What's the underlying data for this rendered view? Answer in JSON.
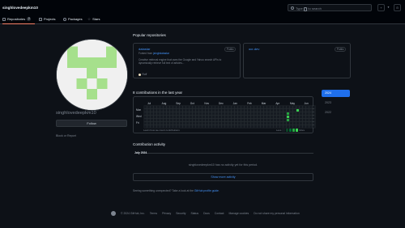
{
  "header": {
    "title": "singhlovedeepkm10",
    "search_placeholder_before": "Type",
    "search_placeholder_key": "/",
    "search_placeholder_after": "to search",
    "buttons": [
      "+",
      "▾",
      "⊙"
    ]
  },
  "tabs": [
    {
      "label": "Repositories",
      "count": "2",
      "icon": "repo-icon"
    },
    {
      "label": "Projects",
      "icon": "project-icon"
    },
    {
      "label": "Packages",
      "icon": "package-icon"
    },
    {
      "label": "Stars",
      "icon": "star-icon"
    }
  ],
  "profile": {
    "name": "singhlovedeepkm10",
    "follow_label": "Follow",
    "block_report": "Block or Report"
  },
  "popular": {
    "title": "Popular repositories",
    "repos": [
      {
        "name": "datastar",
        "badge": "Public",
        "forked_prefix": "Forked from",
        "forked_from": "jsinghdatastar",
        "description": "Creative retrieval engine that uses the Google and Yahoo search APIs to dynamically retrieve full text of articles...",
        "language": "Roff",
        "lang_color": "#ecdebe"
      },
      {
        "name": "ocr-dev",
        "badge": "Public",
        "forked_prefix": "",
        "forked_from": "",
        "description": "",
        "language": "",
        "lang_color": ""
      }
    ]
  },
  "contrib": {
    "title": "8 contributions in the last year",
    "months": [
      "Jul",
      "Aug",
      "Sep",
      "Oct",
      "Nov",
      "Dec",
      "Jan",
      "Feb",
      "Mar",
      "Apr",
      "May",
      "Jun"
    ],
    "days": [
      "Mon",
      "Wed",
      "Fri"
    ],
    "footer_link": "Learn how we count contributions",
    "less": "Less",
    "more": "More",
    "colors": [
      "#161b22",
      "#0e4429",
      "#006d32",
      "#26a641",
      "#39d353"
    ],
    "active_cells": [
      {
        "week": 44,
        "day": 2,
        "level": 3
      },
      {
        "week": 44,
        "day": 3,
        "level": 4
      },
      {
        "week": 44,
        "day": 4,
        "level": 3
      },
      {
        "week": 47,
        "day": 1,
        "level": 4
      }
    ]
  },
  "years": [
    "2024",
    "2023",
    "2022"
  ],
  "activity": {
    "title": "Contribution activity",
    "month": "July 2024",
    "message": "singhlovedeepkm10 has no activity yet for this period.",
    "show_more": "Show more activity",
    "unexpected_prefix": "Seeing something unexpected? Take a look at the",
    "unexpected_link": "GitHub profile guide",
    "unexpected_suffix": "."
  },
  "footer": {
    "copyright": "© 2024 GitHub, Inc.",
    "links": [
      "Terms",
      "Privacy",
      "Security",
      "Status",
      "Docs",
      "Contact",
      "Manage cookies",
      "Do not share my personal information"
    ]
  }
}
